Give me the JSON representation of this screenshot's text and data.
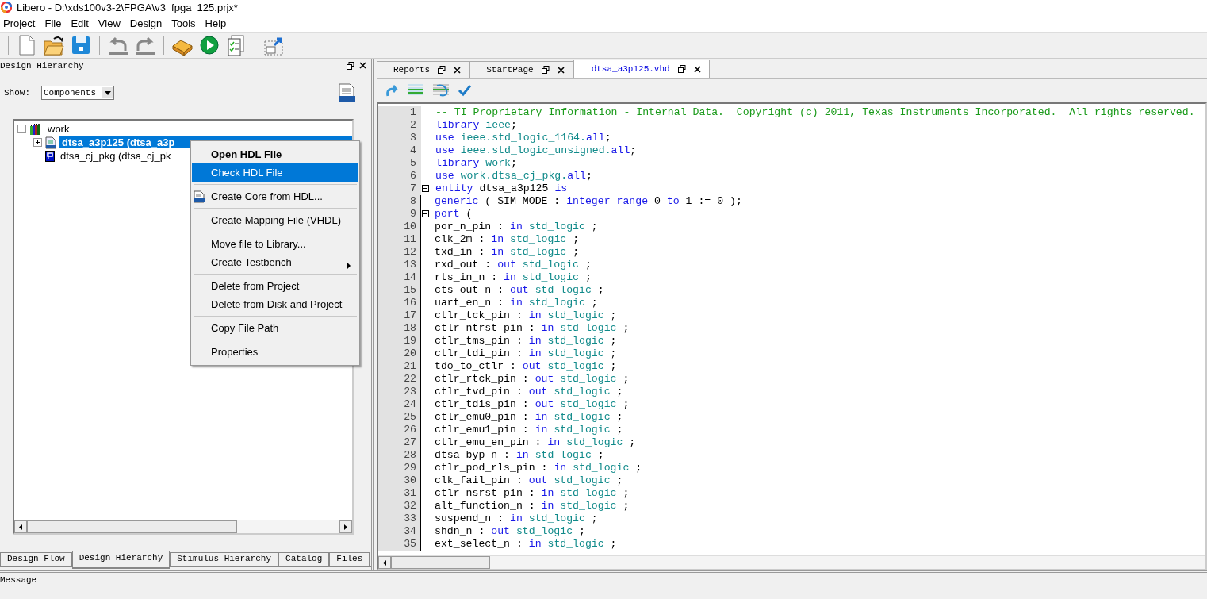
{
  "window": {
    "title": "Libero - D:\\xds100v3-2\\FPGA\\v3_fpga_125.prjx*"
  },
  "menu": [
    "Project",
    "File",
    "Edit",
    "View",
    "Design",
    "Tools",
    "Help"
  ],
  "left_panel": {
    "title": "Design Hierarchy",
    "show_label": "Show:",
    "show_value": "Components",
    "tree": [
      {
        "label": "work",
        "kind": "library",
        "expanded": true,
        "selected": false,
        "children": [
          {
            "label": "dtsa_a3p125 (dtsa_a3p",
            "kind": "hdl",
            "expanded": false,
            "selected": true
          },
          {
            "label": "dtsa_cj_pkg (dtsa_cj_pk",
            "kind": "package",
            "selected": false
          }
        ]
      }
    ],
    "tabs": [
      {
        "label": "Design Flow",
        "selected": false
      },
      {
        "label": "Design Hierarchy",
        "selected": true
      },
      {
        "label": "Stimulus Hierarchy",
        "selected": false
      },
      {
        "label": "Catalog",
        "selected": false
      },
      {
        "label": "Files",
        "selected": false
      }
    ]
  },
  "context_menu": [
    [
      {
        "label": "Open HDL File",
        "kind": "plain",
        "bold": true,
        "selected": false
      },
      {
        "label": "Check HDL File",
        "kind": "plain",
        "bold": false,
        "selected": true
      }
    ],
    [
      {
        "label": "Create Core from HDL...",
        "kind": "hdl_icon",
        "bold": false,
        "selected": false
      }
    ],
    [
      {
        "label": "Create Mapping File (VHDL)",
        "kind": "plain",
        "bold": false,
        "selected": false
      }
    ],
    [
      {
        "label": "Move file to Library...",
        "kind": "plain",
        "bold": false,
        "selected": false
      },
      {
        "label": "Create Testbench",
        "kind": "plain",
        "bold": false,
        "selected": false,
        "submenu": true
      }
    ],
    [
      {
        "label": "Delete from Project",
        "kind": "plain",
        "bold": false,
        "selected": false
      },
      {
        "label": "Delete from Disk and Project",
        "kind": "plain",
        "bold": false,
        "selected": false
      }
    ],
    [
      {
        "label": "Copy File Path",
        "kind": "plain",
        "bold": false,
        "selected": false
      }
    ],
    [
      {
        "label": "Properties",
        "kind": "plain",
        "bold": false,
        "selected": false
      }
    ]
  ],
  "editor": {
    "tabs": [
      {
        "label": "Reports",
        "selected": false
      },
      {
        "label": "StartPage",
        "selected": false
      },
      {
        "label": "dtsa_a3p125.vhd",
        "selected": true
      }
    ],
    "lines": [
      {
        "n": "1",
        "segs": [
          {
            "kind": "comment",
            "text": "-- TI Proprietary Information - Internal Data.  Copyright (c) 2011, Texas Instruments Incorporated.  All rights reserved."
          }
        ]
      },
      {
        "n": "2",
        "segs": [
          {
            "kind": "keyword",
            "text": "library "
          },
          {
            "kind": "type",
            "text": "ieee"
          },
          {
            "kind": "plain",
            "text": ";"
          }
        ]
      },
      {
        "n": "3",
        "segs": [
          {
            "kind": "keyword",
            "text": "use "
          },
          {
            "kind": "type",
            "text": "ieee.std_logic_1164."
          },
          {
            "kind": "keyword",
            "text": "all"
          },
          {
            "kind": "plain",
            "text": ";"
          }
        ]
      },
      {
        "n": "4",
        "segs": [
          {
            "kind": "keyword",
            "text": "use "
          },
          {
            "kind": "type",
            "text": "ieee.std_logic_unsigned."
          },
          {
            "kind": "keyword",
            "text": "all"
          },
          {
            "kind": "plain",
            "text": ";"
          }
        ]
      },
      {
        "n": "5",
        "segs": [
          {
            "kind": "keyword",
            "text": "library "
          },
          {
            "kind": "type",
            "text": "work"
          },
          {
            "kind": "plain",
            "text": ";"
          }
        ]
      },
      {
        "n": "6",
        "segs": [
          {
            "kind": "keyword",
            "text": "use "
          },
          {
            "kind": "type",
            "text": "work.dtsa_cj_pkg."
          },
          {
            "kind": "keyword",
            "text": "all"
          },
          {
            "kind": "plain",
            "text": ";"
          }
        ]
      },
      {
        "n": "7",
        "fold": true,
        "segs": [
          {
            "kind": "keyword",
            "text": "entity"
          },
          {
            "kind": "plain",
            "text": " dtsa_a3p125 "
          },
          {
            "kind": "keyword",
            "text": "is"
          }
        ]
      },
      {
        "n": "8",
        "segs": [
          {
            "kind": "keyword",
            "text": "generic"
          },
          {
            "kind": "plain",
            "text": " ( SIM_MODE : "
          },
          {
            "kind": "keyword",
            "text": "integer range"
          },
          {
            "kind": "plain",
            "text": " 0 "
          },
          {
            "kind": "keyword",
            "text": "to"
          },
          {
            "kind": "plain",
            "text": " 1 := 0 );"
          }
        ]
      },
      {
        "n": "9",
        "fold": true,
        "segs": [
          {
            "kind": "keyword",
            "text": "port"
          },
          {
            "kind": "plain",
            "text": " ("
          }
        ]
      },
      {
        "n": "10",
        "segs": [
          {
            "kind": "plain",
            "text": "por_n_pin : "
          },
          {
            "kind": "keyword",
            "text": "in "
          },
          {
            "kind": "type",
            "text": "std_logic"
          },
          {
            "kind": "plain",
            "text": " ;"
          }
        ]
      },
      {
        "n": "11",
        "segs": [
          {
            "kind": "plain",
            "text": "clk_2m : "
          },
          {
            "kind": "keyword",
            "text": "in "
          },
          {
            "kind": "type",
            "text": "std_logic"
          },
          {
            "kind": "plain",
            "text": " ;"
          }
        ]
      },
      {
        "n": "12",
        "segs": [
          {
            "kind": "plain",
            "text": "txd_in : "
          },
          {
            "kind": "keyword",
            "text": "in "
          },
          {
            "kind": "type",
            "text": "std_logic"
          },
          {
            "kind": "plain",
            "text": " ;"
          }
        ]
      },
      {
        "n": "13",
        "segs": [
          {
            "kind": "plain",
            "text": "rxd_out : "
          },
          {
            "kind": "keyword",
            "text": "out "
          },
          {
            "kind": "type",
            "text": "std_logic"
          },
          {
            "kind": "plain",
            "text": " ;"
          }
        ]
      },
      {
        "n": "14",
        "segs": [
          {
            "kind": "plain",
            "text": "rts_in_n : "
          },
          {
            "kind": "keyword",
            "text": "in "
          },
          {
            "kind": "type",
            "text": "std_logic"
          },
          {
            "kind": "plain",
            "text": " ;"
          }
        ]
      },
      {
        "n": "15",
        "segs": [
          {
            "kind": "plain",
            "text": "cts_out_n : "
          },
          {
            "kind": "keyword",
            "text": "out "
          },
          {
            "kind": "type",
            "text": "std_logic"
          },
          {
            "kind": "plain",
            "text": " ;"
          }
        ]
      },
      {
        "n": "16",
        "segs": [
          {
            "kind": "plain",
            "text": "uart_en_n : "
          },
          {
            "kind": "keyword",
            "text": "in "
          },
          {
            "kind": "type",
            "text": "std_logic"
          },
          {
            "kind": "plain",
            "text": " ;"
          }
        ]
      },
      {
        "n": "17",
        "segs": [
          {
            "kind": "plain",
            "text": "ctlr_tck_pin : "
          },
          {
            "kind": "keyword",
            "text": "in "
          },
          {
            "kind": "type",
            "text": "std_logic"
          },
          {
            "kind": "plain",
            "text": " ;"
          }
        ]
      },
      {
        "n": "18",
        "segs": [
          {
            "kind": "plain",
            "text": "ctlr_ntrst_pin : "
          },
          {
            "kind": "keyword",
            "text": "in "
          },
          {
            "kind": "type",
            "text": "std_logic"
          },
          {
            "kind": "plain",
            "text": " ;"
          }
        ]
      },
      {
        "n": "19",
        "segs": [
          {
            "kind": "plain",
            "text": "ctlr_tms_pin : "
          },
          {
            "kind": "keyword",
            "text": "in "
          },
          {
            "kind": "type",
            "text": "std_logic"
          },
          {
            "kind": "plain",
            "text": " ;"
          }
        ]
      },
      {
        "n": "20",
        "segs": [
          {
            "kind": "plain",
            "text": "ctlr_tdi_pin : "
          },
          {
            "kind": "keyword",
            "text": "in "
          },
          {
            "kind": "type",
            "text": "std_logic"
          },
          {
            "kind": "plain",
            "text": " ;"
          }
        ]
      },
      {
        "n": "21",
        "segs": [
          {
            "kind": "plain",
            "text": "tdo_to_ctlr : "
          },
          {
            "kind": "keyword",
            "text": "out "
          },
          {
            "kind": "type",
            "text": "std_logic"
          },
          {
            "kind": "plain",
            "text": " ;"
          }
        ]
      },
      {
        "n": "22",
        "segs": [
          {
            "kind": "plain",
            "text": "ctlr_rtck_pin : "
          },
          {
            "kind": "keyword",
            "text": "out "
          },
          {
            "kind": "type",
            "text": "std_logic"
          },
          {
            "kind": "plain",
            "text": " ;"
          }
        ]
      },
      {
        "n": "23",
        "segs": [
          {
            "kind": "plain",
            "text": "ctlr_tvd_pin : "
          },
          {
            "kind": "keyword",
            "text": "out "
          },
          {
            "kind": "type",
            "text": "std_logic"
          },
          {
            "kind": "plain",
            "text": " ;"
          }
        ]
      },
      {
        "n": "24",
        "segs": [
          {
            "kind": "plain",
            "text": "ctlr_tdis_pin : "
          },
          {
            "kind": "keyword",
            "text": "out "
          },
          {
            "kind": "type",
            "text": "std_logic"
          },
          {
            "kind": "plain",
            "text": " ;"
          }
        ]
      },
      {
        "n": "25",
        "segs": [
          {
            "kind": "plain",
            "text": "ctlr_emu0_pin : "
          },
          {
            "kind": "keyword",
            "text": "in "
          },
          {
            "kind": "type",
            "text": "std_logic"
          },
          {
            "kind": "plain",
            "text": " ;"
          }
        ]
      },
      {
        "n": "26",
        "segs": [
          {
            "kind": "plain",
            "text": "ctlr_emu1_pin : "
          },
          {
            "kind": "keyword",
            "text": "in "
          },
          {
            "kind": "type",
            "text": "std_logic"
          },
          {
            "kind": "plain",
            "text": " ;"
          }
        ]
      },
      {
        "n": "27",
        "segs": [
          {
            "kind": "plain",
            "text": "ctlr_emu_en_pin : "
          },
          {
            "kind": "keyword",
            "text": "in "
          },
          {
            "kind": "type",
            "text": "std_logic"
          },
          {
            "kind": "plain",
            "text": " ;"
          }
        ]
      },
      {
        "n": "28",
        "segs": [
          {
            "kind": "plain",
            "text": "dtsa_byp_n : "
          },
          {
            "kind": "keyword",
            "text": "in "
          },
          {
            "kind": "type",
            "text": "std_logic"
          },
          {
            "kind": "plain",
            "text": " ;"
          }
        ]
      },
      {
        "n": "29",
        "segs": [
          {
            "kind": "plain",
            "text": "ctlr_pod_rls_pin : "
          },
          {
            "kind": "keyword",
            "text": "in "
          },
          {
            "kind": "type",
            "text": "std_logic"
          },
          {
            "kind": "plain",
            "text": " ;"
          }
        ]
      },
      {
        "n": "30",
        "segs": [
          {
            "kind": "plain",
            "text": "clk_fail_pin : "
          },
          {
            "kind": "keyword",
            "text": "out "
          },
          {
            "kind": "type",
            "text": "std_logic"
          },
          {
            "kind": "plain",
            "text": " ;"
          }
        ]
      },
      {
        "n": "31",
        "segs": [
          {
            "kind": "plain",
            "text": "ctlr_nsrst_pin : "
          },
          {
            "kind": "keyword",
            "text": "in "
          },
          {
            "kind": "type",
            "text": "std_logic"
          },
          {
            "kind": "plain",
            "text": " ;"
          }
        ]
      },
      {
        "n": "32",
        "segs": [
          {
            "kind": "plain",
            "text": "alt_function_n : "
          },
          {
            "kind": "keyword",
            "text": "in "
          },
          {
            "kind": "type",
            "text": "std_logic"
          },
          {
            "kind": "plain",
            "text": " ;"
          }
        ]
      },
      {
        "n": "33",
        "segs": [
          {
            "kind": "plain",
            "text": "suspend_n : "
          },
          {
            "kind": "keyword",
            "text": "in "
          },
          {
            "kind": "type",
            "text": "std_logic"
          },
          {
            "kind": "plain",
            "text": " ;"
          }
        ]
      },
      {
        "n": "34",
        "segs": [
          {
            "kind": "plain",
            "text": "shdn_n : "
          },
          {
            "kind": "keyword",
            "text": "out "
          },
          {
            "kind": "type",
            "text": "std_logic"
          },
          {
            "kind": "plain",
            "text": " ;"
          }
        ]
      },
      {
        "n": "35",
        "segs": [
          {
            "kind": "plain",
            "text": "ext_select_n : "
          },
          {
            "kind": "keyword",
            "text": "in "
          },
          {
            "kind": "type",
            "text": "std_logic"
          },
          {
            "kind": "plain",
            "text": " ;"
          }
        ]
      }
    ]
  },
  "message_panel": {
    "title": "Message"
  }
}
